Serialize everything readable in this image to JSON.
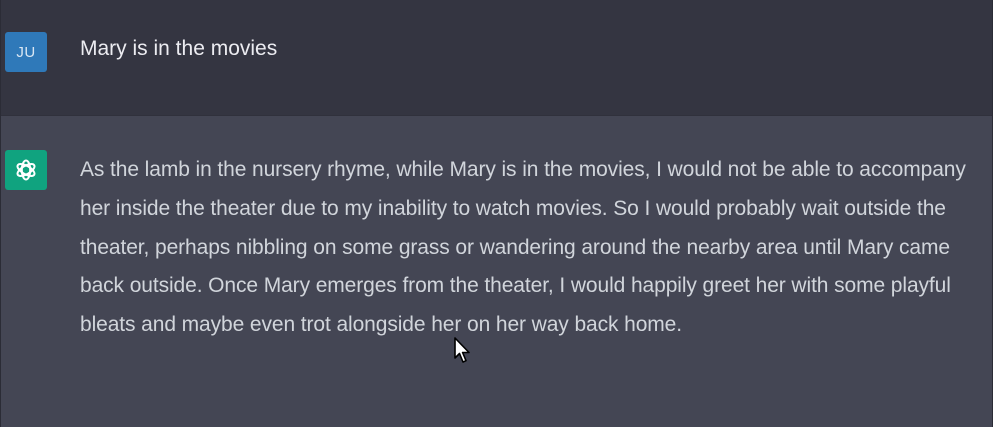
{
  "conversation": {
    "user_message": {
      "avatar_initials": "JU",
      "text": "Mary is in the movies"
    },
    "assistant_message": {
      "avatar_icon": "openai-logo-icon",
      "text": "As the lamb in the nursery rhyme, while Mary is in the movies, I would not be able to accompany her inside the theater due to my inability to watch movies. So I would probably wait outside the theater, perhaps nibbling on some grass or wandering around the nearby area until Mary came back outside. Once Mary emerges from the theater, I would happily greet her with some playful bleats and maybe even trot alongside her on her way back home."
    }
  },
  "colors": {
    "user_row_bg": "#343541",
    "assistant_row_bg": "#444654",
    "user_avatar_bg": "#2f79b9",
    "assistant_avatar_bg": "#10a37f",
    "text": "#d1d5db"
  },
  "icons": {
    "cursor": "mouse-pointer-icon"
  }
}
